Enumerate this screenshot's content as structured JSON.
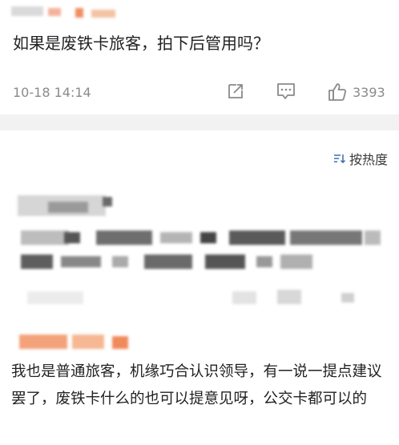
{
  "top_comment": {
    "text": "如果是废铁卡旅客，拍下后管用吗？",
    "time": "10-18 14:14",
    "like_count": "3393",
    "icons": [
      "share-icon",
      "comment-icon",
      "thumbs-up-icon"
    ]
  },
  "sort": {
    "label": "按热度",
    "icon": "sort-lines-icon"
  },
  "reply": {
    "text": "我也是普通旅客，机缘巧合认识领导，有一说一提点建议罢了，废铁卡什么的也可以提意见呀，公交卡都可以的"
  },
  "colors": {
    "muted": "#8a8a8a",
    "divider": "#f2f2f2",
    "redacted_orange": "#f08a5d"
  }
}
